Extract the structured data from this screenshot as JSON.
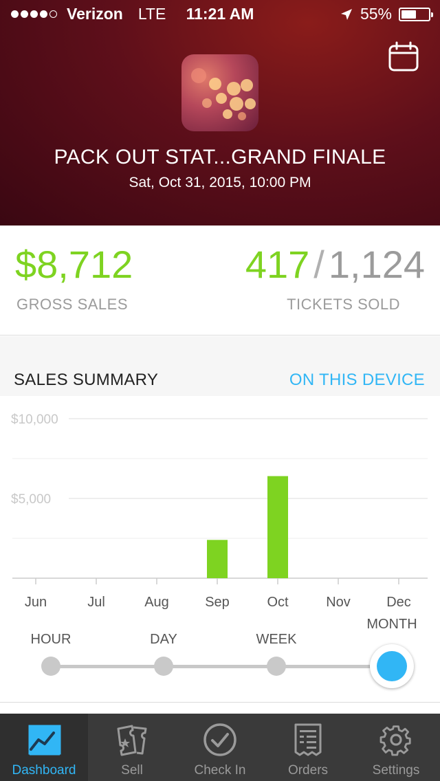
{
  "status_bar": {
    "carrier": "Verizon",
    "network": "LTE",
    "time": "11:21 AM",
    "battery_percent": "55%",
    "battery_level": 0.55,
    "signal_bars_filled": 4,
    "signal_bars_total": 5
  },
  "header": {
    "event_title": "PACK OUT STAT...GRAND FINALE",
    "event_date": "Sat, Oct 31, 2015, 10:00 PM",
    "calendar_icon": "calendar-icon"
  },
  "stats": {
    "gross_sales_value": "$8,712",
    "gross_sales_label": "GROSS SALES",
    "tickets_sold": "417",
    "tickets_separator": "/",
    "tickets_total": "1,124",
    "tickets_label": "TICKETS SOLD"
  },
  "summary": {
    "title": "SALES SUMMARY",
    "filter_link": "ON THIS DEVICE"
  },
  "chart_data": {
    "type": "bar",
    "categories": [
      "Jun",
      "Jul",
      "Aug",
      "Sep",
      "Oct",
      "Nov",
      "Dec"
    ],
    "values": [
      0,
      0,
      0,
      2400,
      6400,
      0,
      0
    ],
    "ylim": [
      0,
      10000
    ],
    "y_ticks": [
      "$10,000",
      "$5,000"
    ],
    "y_tick_values": [
      10000,
      5000
    ],
    "grid": true,
    "bar_color": "#7ed321"
  },
  "time_scale": {
    "options": [
      "HOUR",
      "DAY",
      "WEEK",
      "MONTH"
    ],
    "selected": "MONTH"
  },
  "tabs": [
    {
      "label": "Dashboard",
      "icon": "chart-line-icon",
      "active": true
    },
    {
      "label": "Sell",
      "icon": "tickets-icon",
      "active": false
    },
    {
      "label": "Check In",
      "icon": "check-circle-icon",
      "active": false
    },
    {
      "label": "Orders",
      "icon": "receipt-icon",
      "active": false
    },
    {
      "label": "Settings",
      "icon": "gear-icon",
      "active": false
    }
  ],
  "colors": {
    "accent_green": "#7ed321",
    "accent_blue": "#31b6f5",
    "header_bg": "#5e0f1a",
    "tabbar_bg": "#3a3a3a"
  }
}
